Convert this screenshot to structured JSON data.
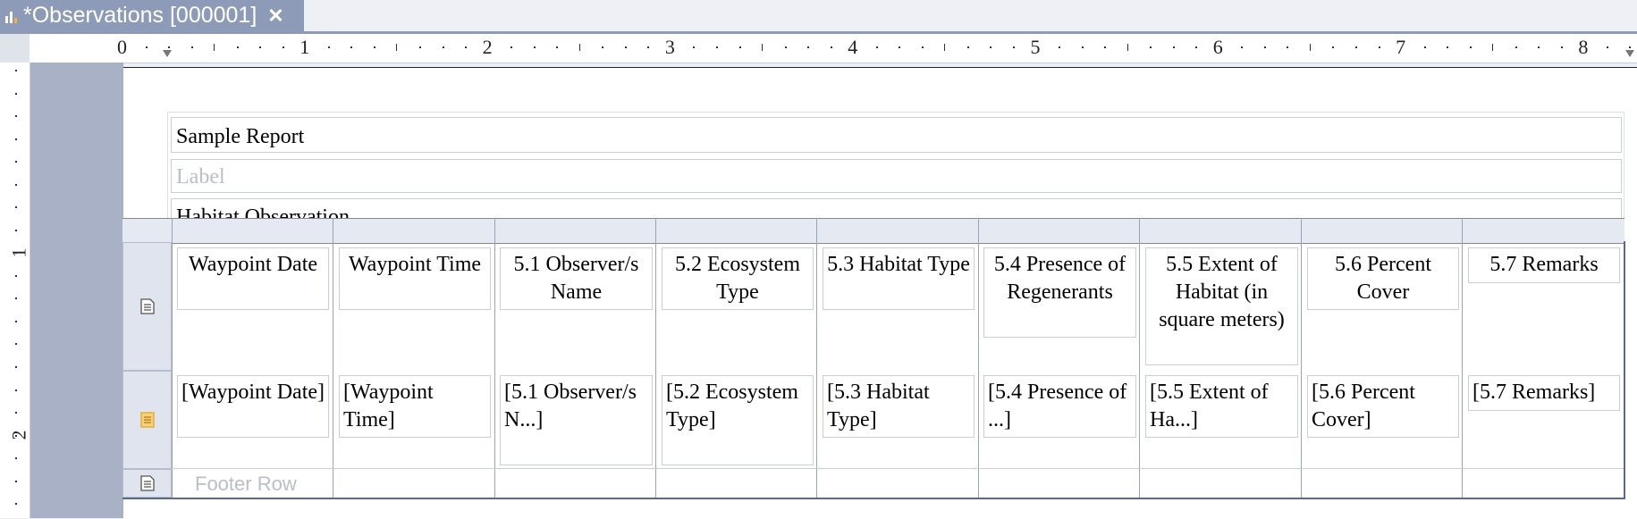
{
  "tab": {
    "title": "*Observations [000001]",
    "close_glyph": "✕"
  },
  "ruler": {
    "top_numbers": [
      "0",
      "1",
      "2",
      "3",
      "4",
      "5",
      "6",
      "7",
      "8"
    ],
    "left_numbers": [
      "1",
      "2"
    ]
  },
  "report": {
    "title": "Sample Report",
    "label_placeholder": "Label",
    "group_header": "Habitat Observation"
  },
  "table": {
    "headers": [
      "Waypoint Date",
      "Waypoint Time",
      "5.1 Observer/s Name",
      "5.2 Ecosystem Type",
      "5.3 Habitat Type",
      "5.4 Presence of Regenerants",
      "5.5 Extent of Habitat (in square meters)",
      "5.6 Percent Cover",
      "5.7 Remarks"
    ],
    "details": [
      "[Waypoint Date]",
      "[Waypoint Time]",
      "[5.1 Observer/s N...]",
      "[5.2 Ecosystem Type]",
      "[5.3 Habitat Type]",
      "[5.4 Presence of ...]",
      "[5.5 Extent of Ha...]",
      "[5.6 Percent Cover]",
      "[5.7 Remarks]"
    ],
    "footer_label": "Footer Row"
  },
  "colors": {
    "tab": "#8e9bb8",
    "margin": "#a8b1c6",
    "detail_icon": "#e8a623"
  },
  "icons": [
    "report-app-icon",
    "close-icon",
    "header-row-icon",
    "detail-row-icon",
    "footer-row-icon"
  ]
}
